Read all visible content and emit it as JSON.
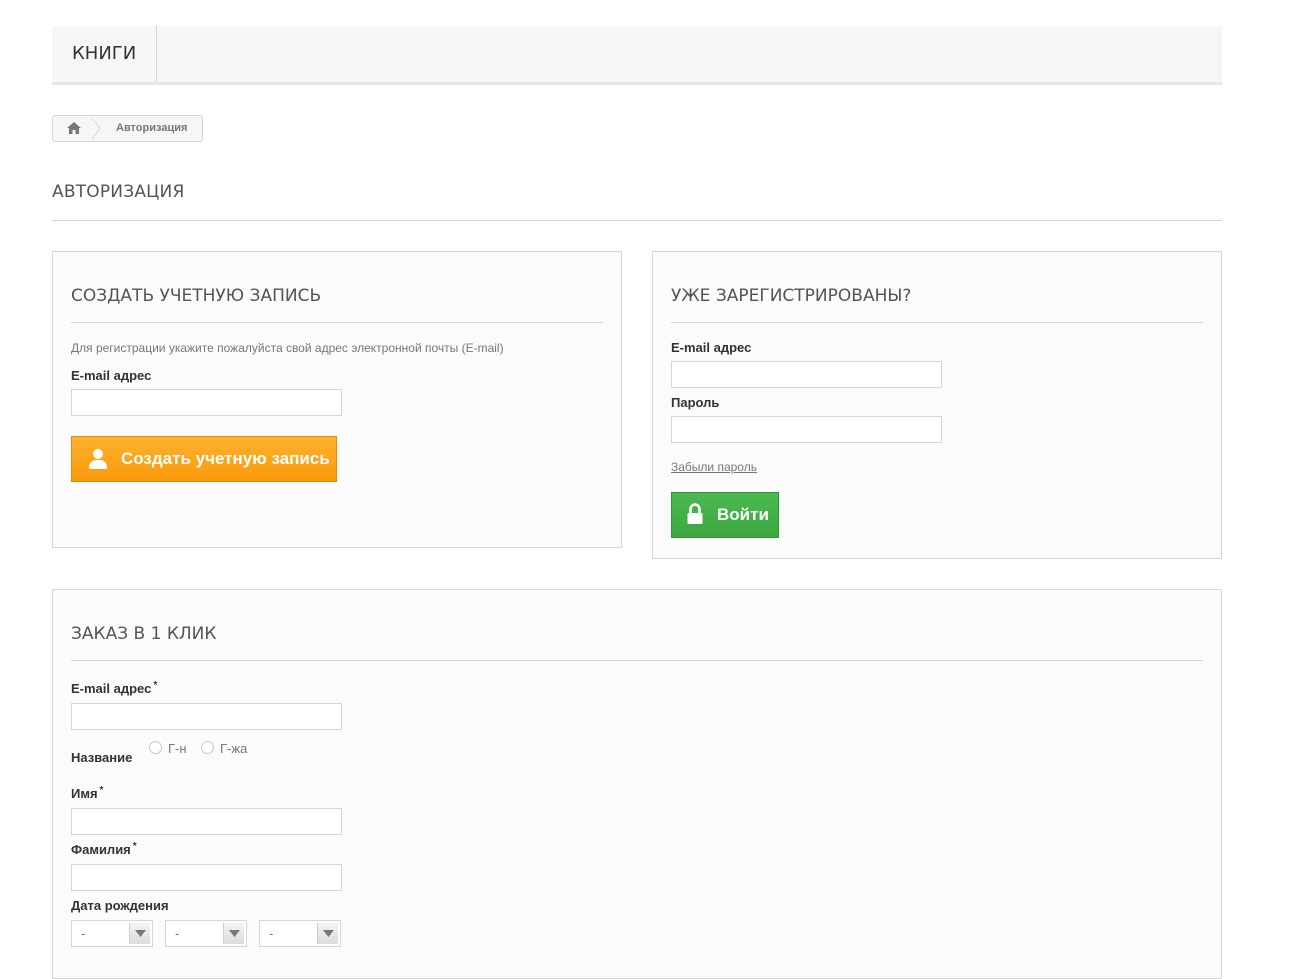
{
  "topnav": {
    "tab": "КНИГИ"
  },
  "breadcrumb": {
    "home_icon": "home-icon",
    "current": "Авторизация"
  },
  "page_heading": "АВТОРИЗАЦИЯ",
  "create_account": {
    "title": "СОЗДАТЬ УЧЕТНУЮ ЗАПИСЬ",
    "hint": "Для регистрации укажите пожалуйста свой адрес электронной почты (E-mail)",
    "email_label": "E-mail адрес",
    "email_value": "",
    "button_label": "Создать учетную запись",
    "button_icon": "user-icon",
    "button_color": "#fa9f11"
  },
  "login": {
    "title": "УЖЕ ЗАРЕГИСТРИРОВАНЫ?",
    "email_label": "E-mail адрес",
    "email_value": "",
    "password_label": "Пароль",
    "password_value": "",
    "forgot_label": "Забыли пароль",
    "button_label": "Войти",
    "button_icon": "lock-icon",
    "button_color": "#43b047"
  },
  "one_click": {
    "title": "ЗАКАЗ В 1 КЛИК",
    "email_label": "E-mail адрес",
    "required_mark": "*",
    "title_label": "Название",
    "title_options": [
      "Г-н",
      "Г-жа"
    ],
    "first_name_label": "Имя",
    "last_name_label": "Фамилия",
    "birthdate_label": "Дата рождения",
    "birthdate_selects": [
      "-",
      "-",
      "-"
    ]
  }
}
